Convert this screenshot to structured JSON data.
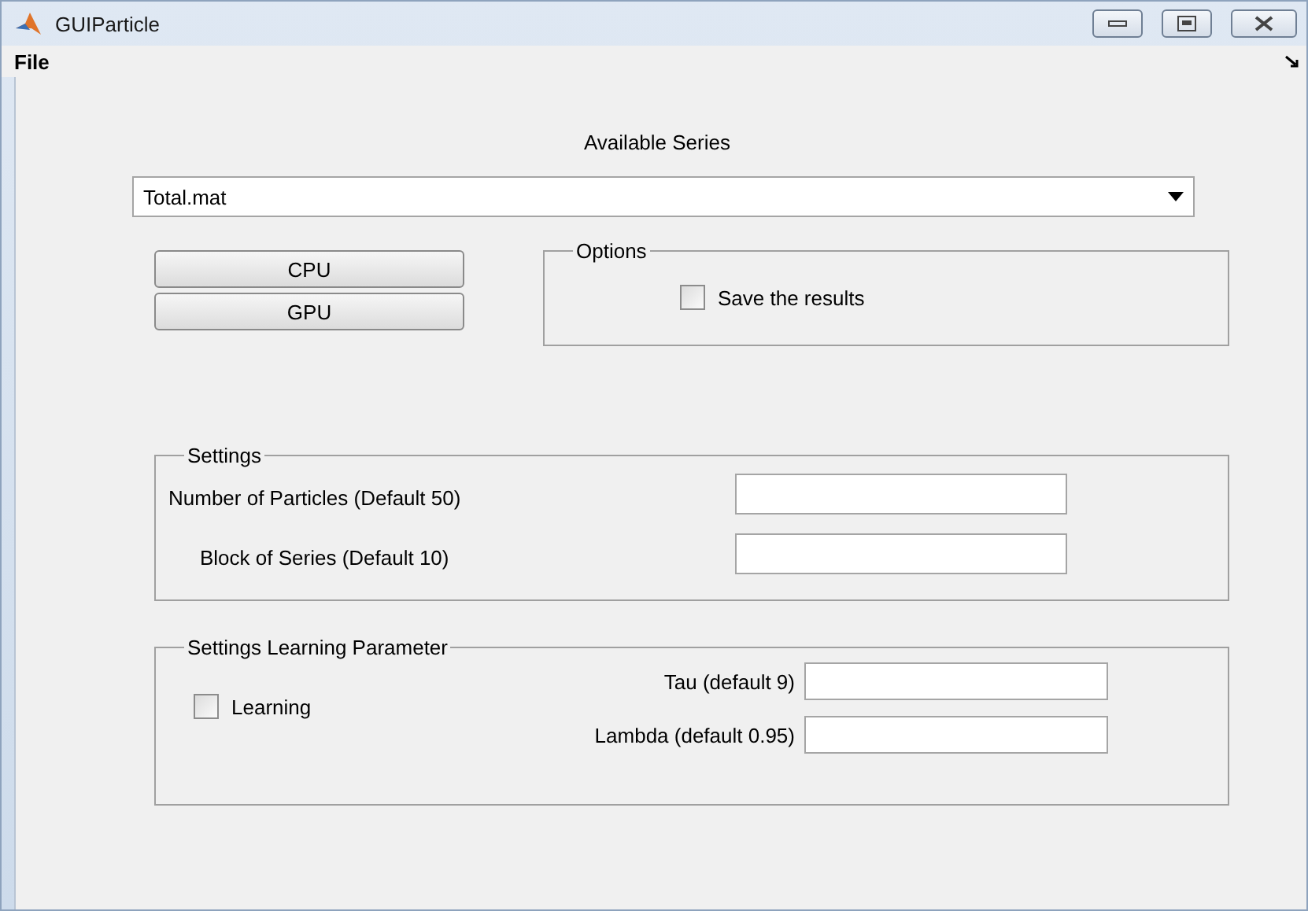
{
  "window": {
    "title": "GUIParticle"
  },
  "menu": [
    {
      "label": "File"
    }
  ],
  "series": {
    "label": "Available Series",
    "value": "Total.mat"
  },
  "buttons": [
    {
      "label": "CPU"
    },
    {
      "label": "GPU"
    }
  ],
  "options": {
    "title": "Options",
    "checkbox": {
      "label": "Save the results",
      "checked": false
    }
  },
  "settings": {
    "title": "Settings",
    "fields": [
      {
        "label": "Number of Particles (Default 50)"
      },
      {
        "label": "Block of Series (Default 10)"
      }
    ]
  },
  "learning": {
    "title": "Settings Learning Parameter",
    "checkbox": {
      "label": "Learning",
      "checked": false
    },
    "fields": [
      {
        "label": "Tau (default 9)"
      },
      {
        "label": "Lambda (default 0.95)"
      }
    ]
  }
}
